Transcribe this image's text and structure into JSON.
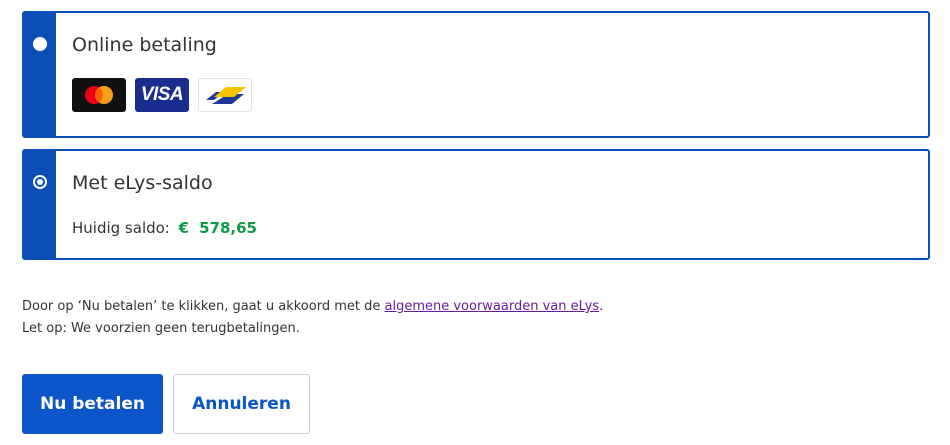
{
  "payment_options": {
    "online": {
      "title": "Online betaling",
      "selected": false,
      "logos": [
        "mastercard-logo",
        "visa-logo",
        "bancontact-logo"
      ],
      "visa_text": "VISA"
    },
    "saldo": {
      "title": "Met eLys-saldo",
      "selected": true,
      "balance_label": "Huidig saldo:",
      "currency": "€",
      "balance_value": "578,65"
    }
  },
  "terms": {
    "prefix": "Door op ‘Nu betalen’ te klikken, gaat u akkoord met de ",
    "link": "algemene voorwaarden van eLys",
    "suffix": ".",
    "note": "Let op: We voorzien geen terugbetalingen."
  },
  "actions": {
    "pay_label": "Nu betalen",
    "cancel_label": "Annuleren"
  },
  "colors": {
    "brand_blue": "#0b4fb6",
    "balance_green": "#0e9a45",
    "link_purple": "#6a1c9e"
  }
}
